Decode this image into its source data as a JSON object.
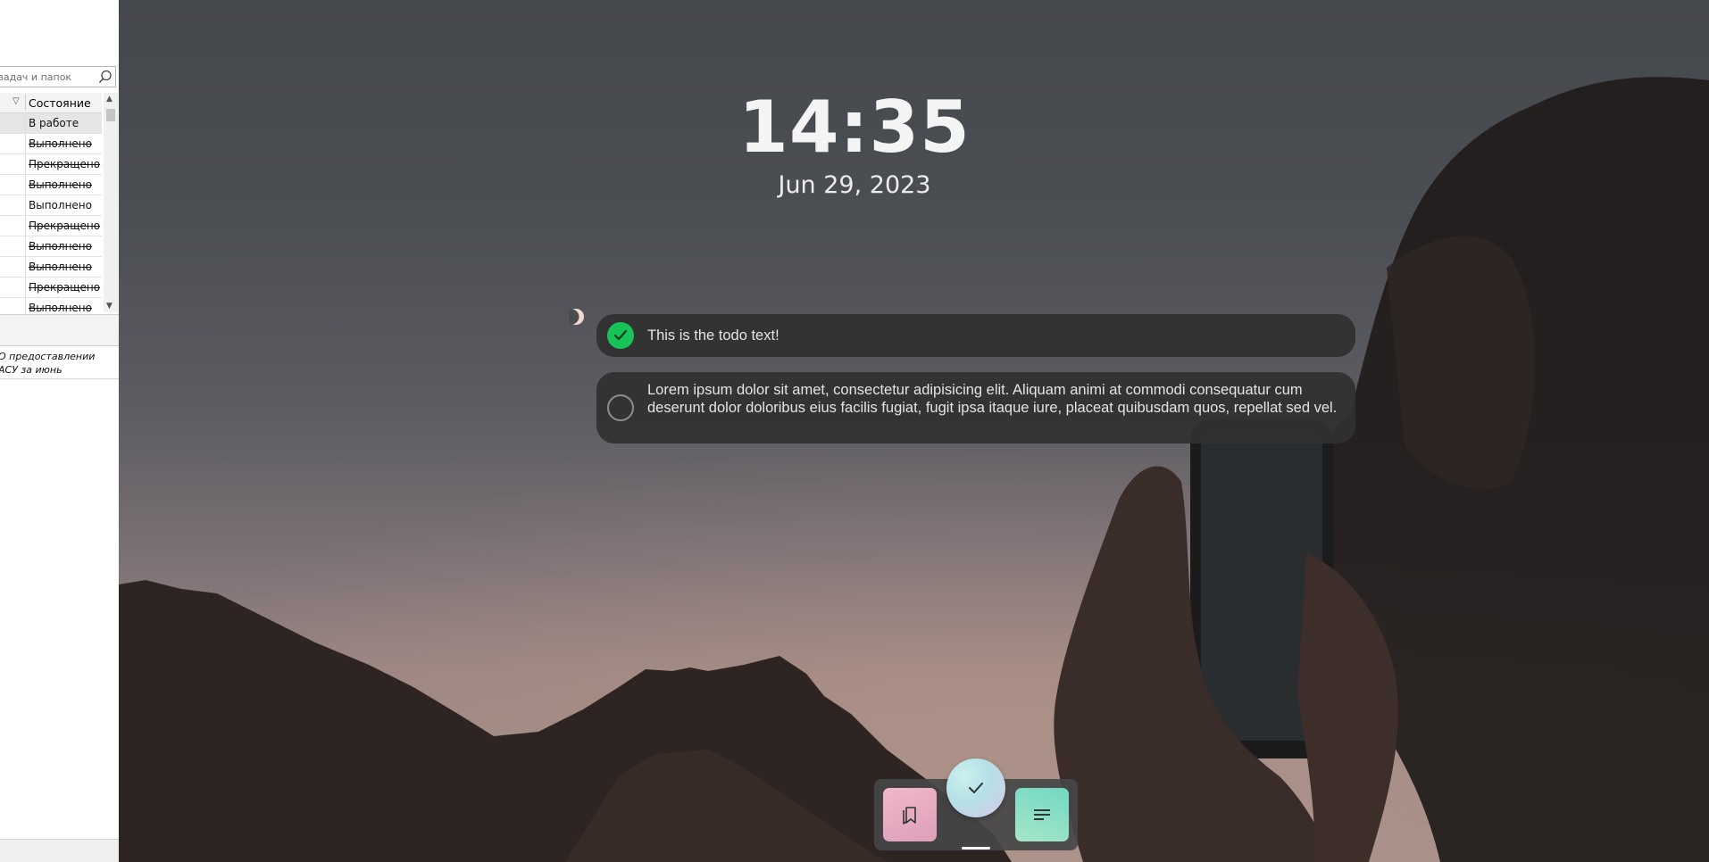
{
  "task_window": {
    "search_placeholder": "задач и папок",
    "column_header": "Состояние",
    "rows": [
      {
        "status": "В работе",
        "strike": false,
        "selected": true
      },
      {
        "status": "Выполнено",
        "strike": true,
        "selected": false
      },
      {
        "status": "Прекращено",
        "strike": true,
        "selected": false
      },
      {
        "status": "Выполнено",
        "strike": true,
        "selected": false
      },
      {
        "status": "Выполнено",
        "strike": false,
        "selected": false
      },
      {
        "status": "Прекращено",
        "strike": true,
        "selected": false
      },
      {
        "status": "Выполнено",
        "strike": true,
        "selected": false
      },
      {
        "status": "Выполнено",
        "strike": true,
        "selected": false
      },
      {
        "status": "Прекращено",
        "strike": true,
        "selected": false
      },
      {
        "status": "Выполнено",
        "strike": true,
        "selected": false
      }
    ],
    "detail_line1": "О предоставлении",
    "detail_line2": "АСУ за июнь"
  },
  "clock": {
    "time": "14:35",
    "date": "Jun 29, 2023"
  },
  "todos": [
    {
      "text": "This is the todo text!",
      "done": true
    },
    {
      "text": "Lorem ipsum dolor sit amet, consectetur adipisicing elit. Aliquam animi at commodi consequatur cum deserunt dolor doloribus eius facilis fugiat, fugit ipsa itaque iure, placeat quibusdam quos, repellat sed vel.",
      "done": false
    }
  ],
  "dock": {
    "items": [
      {
        "icon": "bookmarks-icon",
        "color": "#e8aec4"
      },
      {
        "icon": "checkmark-icon",
        "color": "#bfe6e9",
        "active": true
      },
      {
        "icon": "notes-icon",
        "color": "#8fe0c6"
      }
    ]
  },
  "colors": {
    "todo_check_done": "#18c45a",
    "todo_bg": "#303030"
  }
}
